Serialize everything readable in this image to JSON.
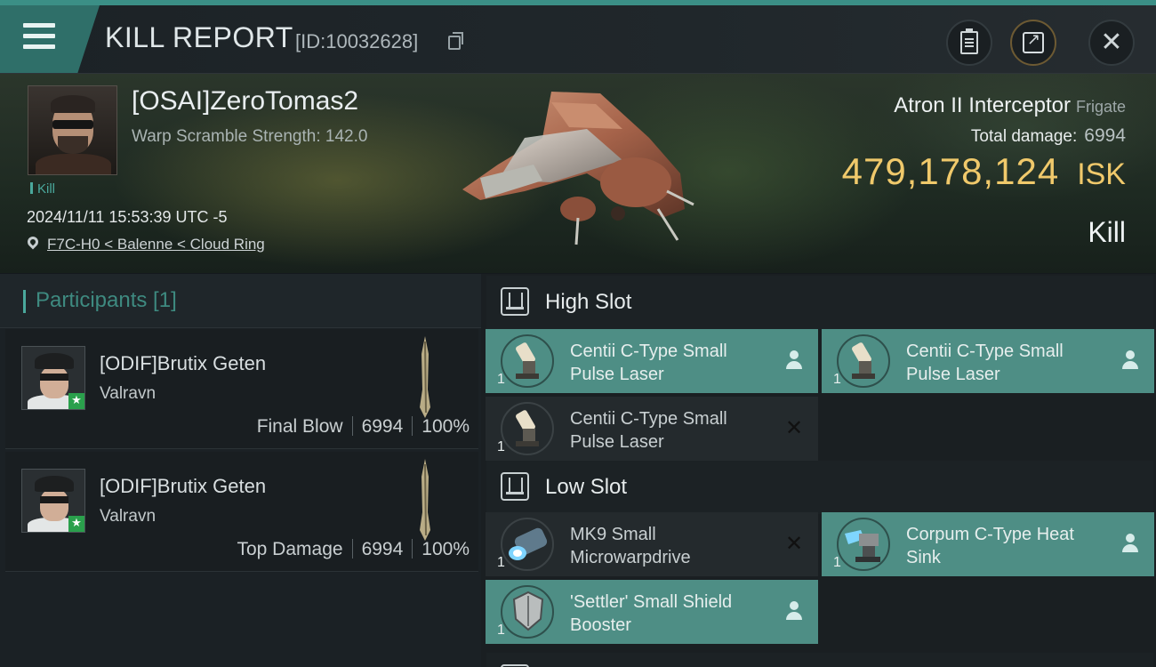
{
  "header": {
    "title": "KILL REPORT",
    "report_id": "[ID:10032628]"
  },
  "victim": {
    "name": "[OSAI]ZeroTomas2",
    "warp_scramble": "Warp Scramble Strength: 142.0",
    "tag": "Kill",
    "timestamp": "2024/11/11 15:53:39 UTC -5",
    "location": "F7C-H0 < Balenne < Cloud Ring"
  },
  "ship": {
    "name": "Atron II Interceptor",
    "class": "Frigate",
    "total_damage_label": "Total damage:",
    "total_damage": "6994",
    "isk_value": "479,178,124",
    "isk_unit": "ISK",
    "result": "Kill"
  },
  "participants": {
    "title": "Participants [1]",
    "items": [
      {
        "name": "[ODIF]Brutix Geten",
        "ship": "Valravn",
        "role": "Final Blow",
        "damage": "6994",
        "percent": "100%"
      },
      {
        "name": "[ODIF]Brutix Geten",
        "ship": "Valravn",
        "role": "Top Damage",
        "damage": "6994",
        "percent": "100%"
      }
    ]
  },
  "slots": {
    "high": {
      "title": "High Slot",
      "modules": [
        {
          "name": "Centii C-Type Small Pulse Laser",
          "qty": "1",
          "state": "active",
          "icon": "person-icon"
        },
        {
          "name": "Centii C-Type Small Pulse Laser",
          "qty": "1",
          "state": "active",
          "icon": "person-icon"
        },
        {
          "name": "Centii C-Type Small Pulse Laser",
          "qty": "1",
          "state": "destroyed",
          "icon": "x-icon"
        }
      ]
    },
    "low": {
      "title": "Low Slot",
      "modules": [
        {
          "name": "MK9 Small Microwarpdrive",
          "qty": "1",
          "state": "destroyed",
          "icon": "x-icon"
        },
        {
          "name": "Corpum C-Type Heat Sink",
          "qty": "1",
          "state": "active",
          "icon": "person-icon"
        },
        {
          "name": "'Settler' Small Shield Booster",
          "qty": "1",
          "state": "active",
          "icon": "person-icon"
        }
      ]
    }
  },
  "colors": {
    "accent": "#4aa89c",
    "active_module": "#4e8e85",
    "isk": "#f0c96b"
  }
}
